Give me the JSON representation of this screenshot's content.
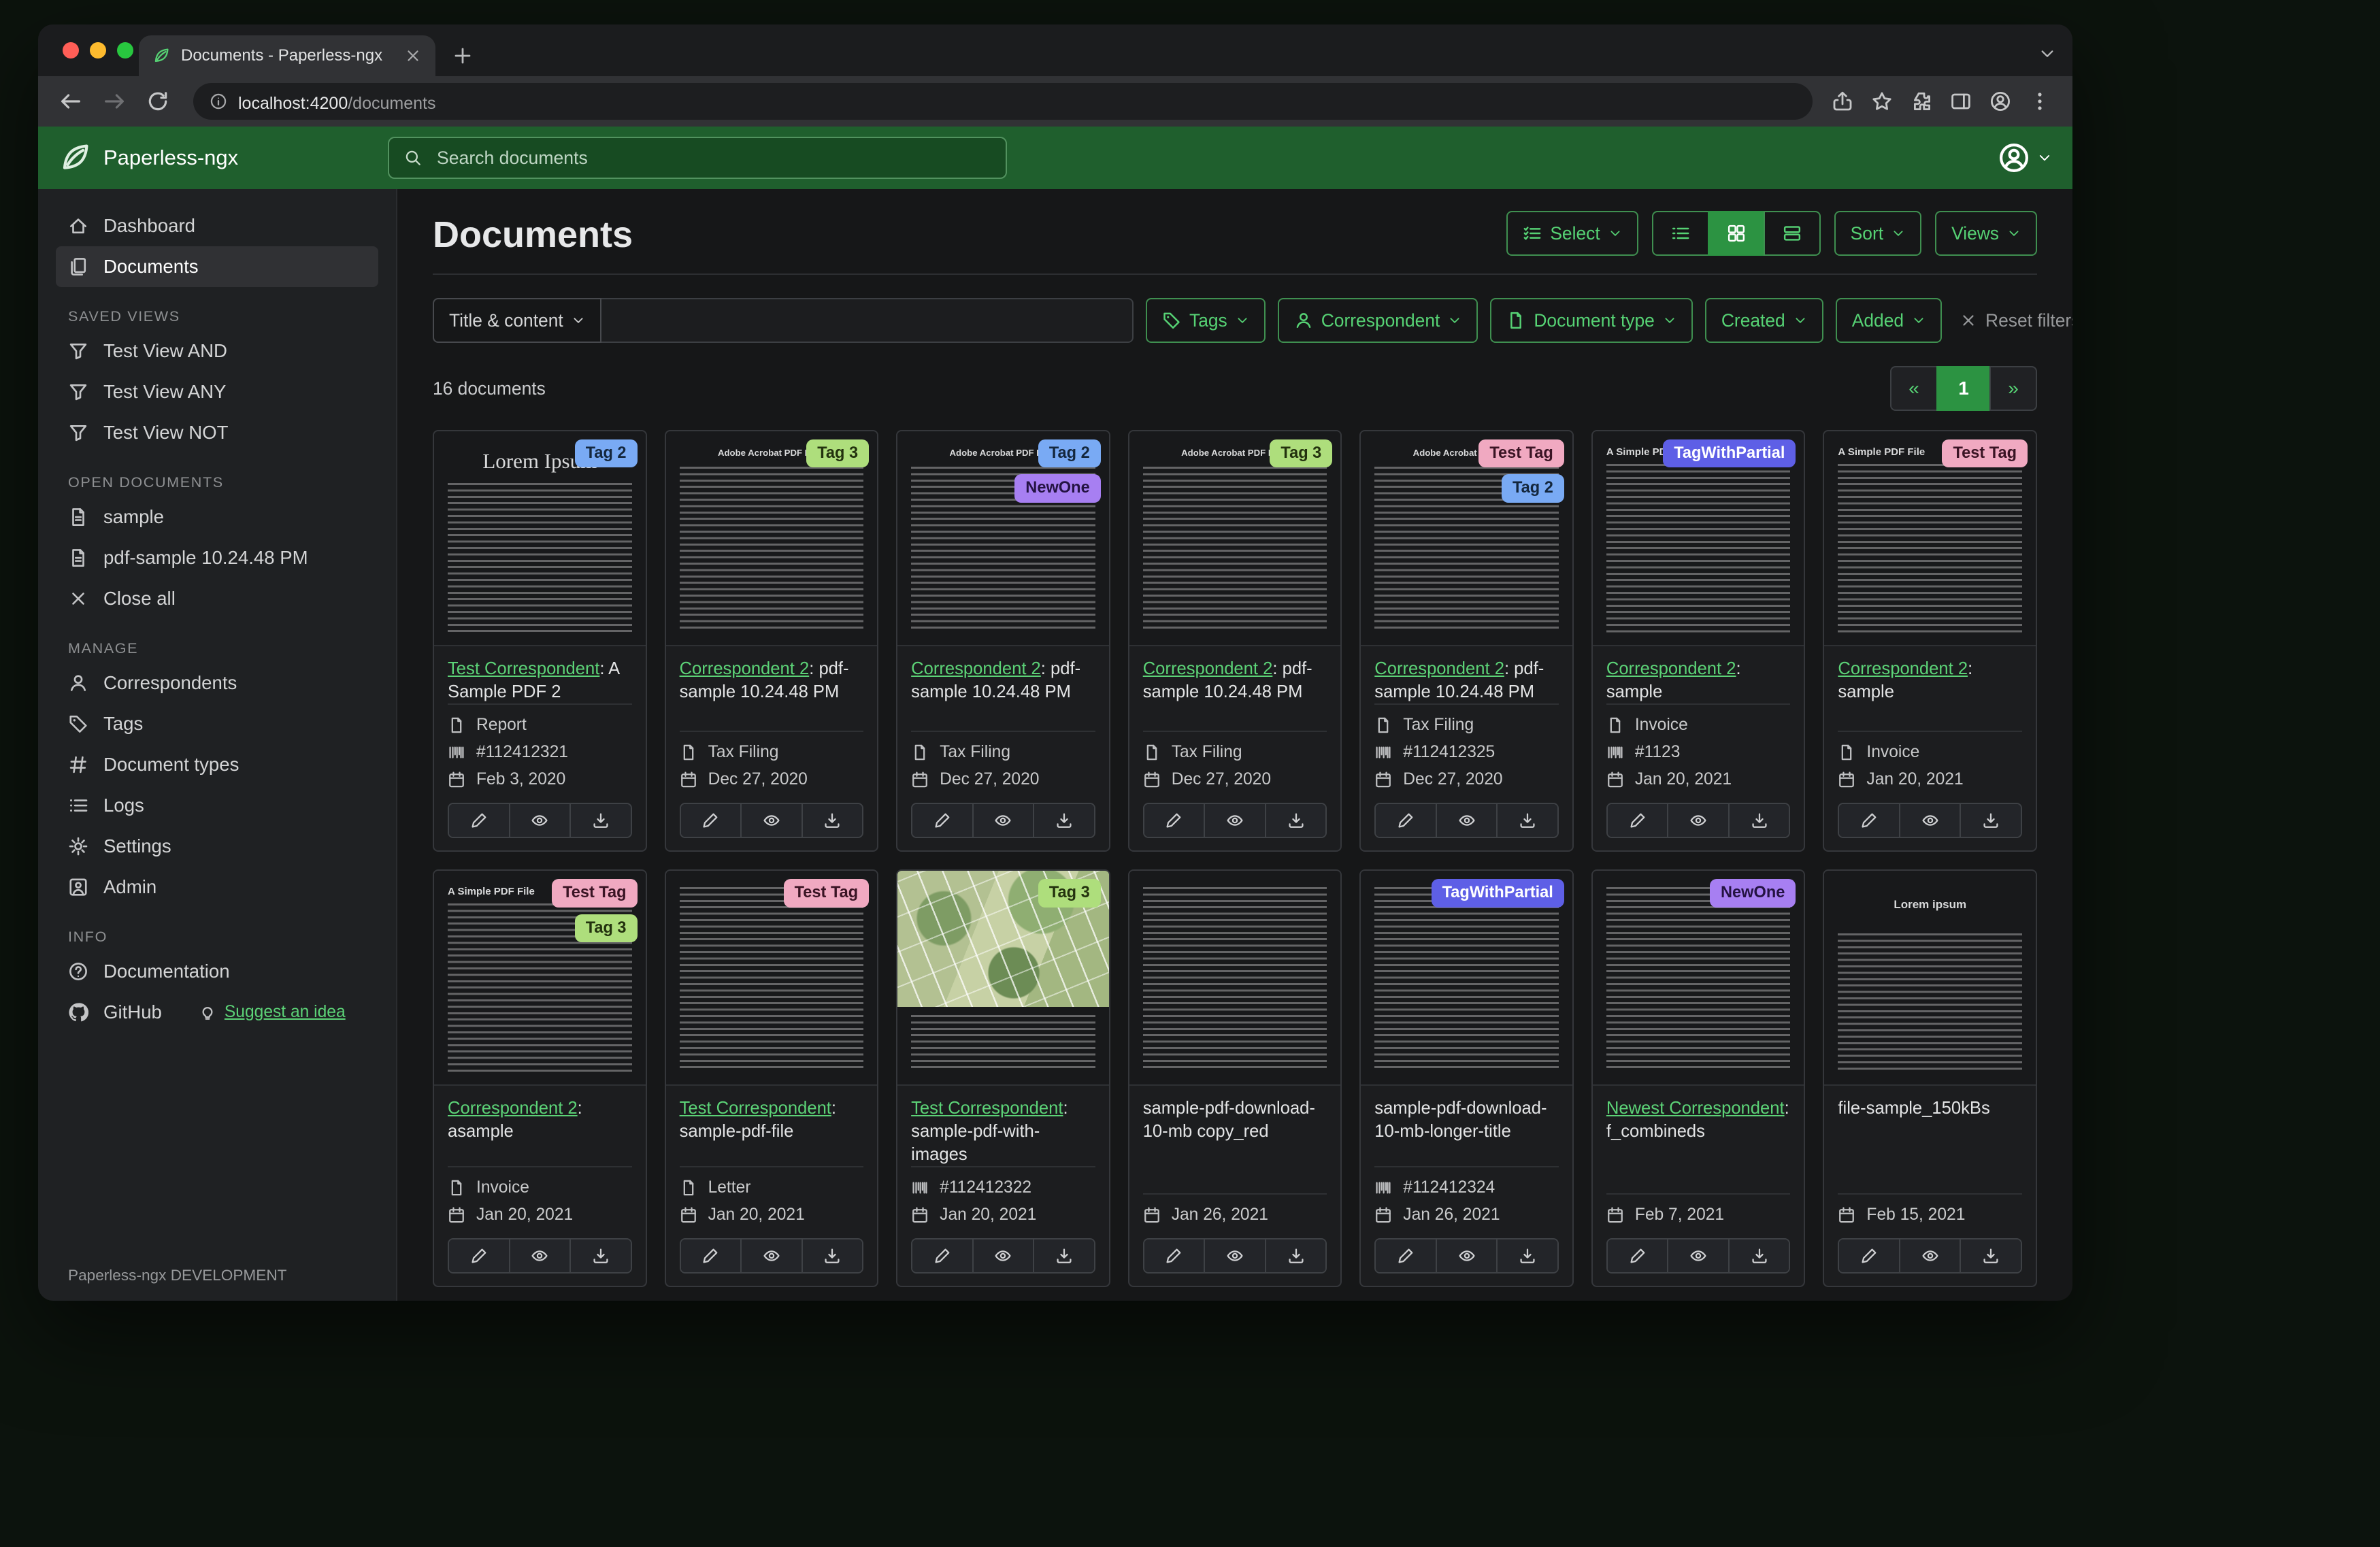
{
  "browser": {
    "tab_title": "Documents - Paperless-ngx",
    "url_host": "localhost:4200",
    "url_path": "/documents"
  },
  "header": {
    "app_name": "Paperless-ngx",
    "search_placeholder": "Search documents"
  },
  "sidebar": {
    "dashboard": "Dashboard",
    "documents": "Documents",
    "saved_views_header": "SAVED VIEWS",
    "saved_views": [
      "Test View AND",
      "Test View ANY",
      "Test View NOT"
    ],
    "open_documents_header": "OPEN DOCUMENTS",
    "open_documents": [
      "sample",
      "pdf-sample 10.24.48 PM"
    ],
    "close_all": "Close all",
    "manage_header": "MANAGE",
    "manage": [
      {
        "label": "Correspondents",
        "icon": "person"
      },
      {
        "label": "Tags",
        "icon": "tag"
      },
      {
        "label": "Document types",
        "icon": "hash"
      },
      {
        "label": "Logs",
        "icon": "list"
      },
      {
        "label": "Settings",
        "icon": "gear"
      },
      {
        "label": "Admin",
        "icon": "person-square"
      }
    ],
    "info_header": "INFO",
    "documentation": "Documentation",
    "github": "GitHub",
    "suggest_idea": "Suggest an idea",
    "footer": "Paperless-ngx DEVELOPMENT"
  },
  "main": {
    "title": "Documents",
    "select_label": "Select",
    "sort_label": "Sort",
    "views_label": "Views",
    "count_label": "16 documents",
    "page_prev": "«",
    "page_current": "1",
    "page_next": "»"
  },
  "filters": {
    "field_label": "Title & content",
    "query_value": "",
    "tags_label": "Tags",
    "correspondent_label": "Correspondent",
    "document_type_label": "Document type",
    "created_label": "Created",
    "added_label": "Added",
    "reset_label": "Reset filters"
  },
  "tag_colors": {
    "Tag 2": {
      "bg": "#79aaf4",
      "fg": "#14273d"
    },
    "Tag 3": {
      "bg": "#aede7c",
      "fg": "#23320e"
    },
    "NewOne": {
      "bg": "#a77ff2",
      "fg": "#241343"
    },
    "Test Tag": {
      "bg": "#f0a9c1",
      "fg": "#3a1424"
    },
    "TagWithPartial": {
      "bg": "#5e5fe6",
      "fg": "#ffffff"
    }
  },
  "thumb_headings": {
    "lorem": "Lorem Ipsum",
    "acrobat": "Adobe Acrobat PDF Files",
    "simple": "A Simple PDF File",
    "lorem2": "Lorem ipsum"
  },
  "documents": [
    {
      "tags": [
        "Tag 2"
      ],
      "thumb": "lorem",
      "correspondent": "Test Correspondent",
      "title": "A Sample PDF 2",
      "type": "Report",
      "asn": "#112412321",
      "date": "Feb 3, 2020"
    },
    {
      "tags": [
        "Tag 3"
      ],
      "thumb": "acrobat",
      "correspondent": "Correspondent 2",
      "title": "pdf-sample 10.24.48 PM",
      "type": "Tax Filing",
      "date": "Dec 27, 2020"
    },
    {
      "tags": [
        "Tag 2",
        "NewOne"
      ],
      "thumb": "acrobat",
      "correspondent": "Correspondent 2",
      "title": "pdf-sample 10.24.48 PM",
      "type": "Tax Filing",
      "date": "Dec 27, 2020"
    },
    {
      "tags": [
        "Tag 3"
      ],
      "thumb": "acrobat",
      "correspondent": "Correspondent 2",
      "title": "pdf-sample 10.24.48 PM",
      "type": "Tax Filing",
      "date": "Dec 27, 2020"
    },
    {
      "tags": [
        "Test Tag",
        "Tag 2"
      ],
      "thumb": "acrobat",
      "correspondent": "Correspondent 2",
      "title": "pdf-sample 10.24.48 PM",
      "type": "Tax Filing",
      "asn": "#112412325",
      "date": "Dec 27, 2020"
    },
    {
      "tags": [
        "TagWithPartial"
      ],
      "thumb": "simple",
      "correspondent": "Correspondent 2",
      "title": "sample",
      "type": "Invoice",
      "asn": "#1123",
      "date": "Jan 20, 2021"
    },
    {
      "tags": [
        "Test Tag"
      ],
      "thumb": "simple",
      "correspondent": "Correspondent 2",
      "title": "sample",
      "type": "Invoice",
      "date": "Jan 20, 2021"
    },
    {
      "tags": [
        "Test Tag",
        "Tag 3"
      ],
      "thumb": "simple",
      "correspondent": "Correspondent 2",
      "title": "asample",
      "type": "Invoice",
      "date": "Jan 20, 2021"
    },
    {
      "tags": [
        "Test Tag"
      ],
      "thumb": "dense",
      "correspondent": "Test Correspondent",
      "title": "sample-pdf-file",
      "type": "Letter",
      "date": "Jan 20, 2021"
    },
    {
      "tags": [
        "Tag 3"
      ],
      "thumb": "map",
      "correspondent": "Test Correspondent",
      "title": "sample-pdf-with-images",
      "asn": "#112412322",
      "date": "Jan 20, 2021"
    },
    {
      "tags": [],
      "thumb": "dense",
      "title": "sample-pdf-download-10-mb copy_red",
      "date": "Jan 26, 2021"
    },
    {
      "tags": [
        "TagWithPartial"
      ],
      "thumb": "dense",
      "title": "sample-pdf-download-10-mb-longer-title",
      "asn": "#112412324",
      "date": "Jan 26, 2021"
    },
    {
      "tags": [
        "NewOne"
      ],
      "thumb": "dense",
      "correspondent": "Newest Correspondent",
      "title": "f_combineds",
      "date": "Feb 7, 2021"
    },
    {
      "tags": [],
      "thumb": "lorem2",
      "title": "file-sample_150kBs",
      "date": "Feb 15, 2021"
    }
  ]
}
